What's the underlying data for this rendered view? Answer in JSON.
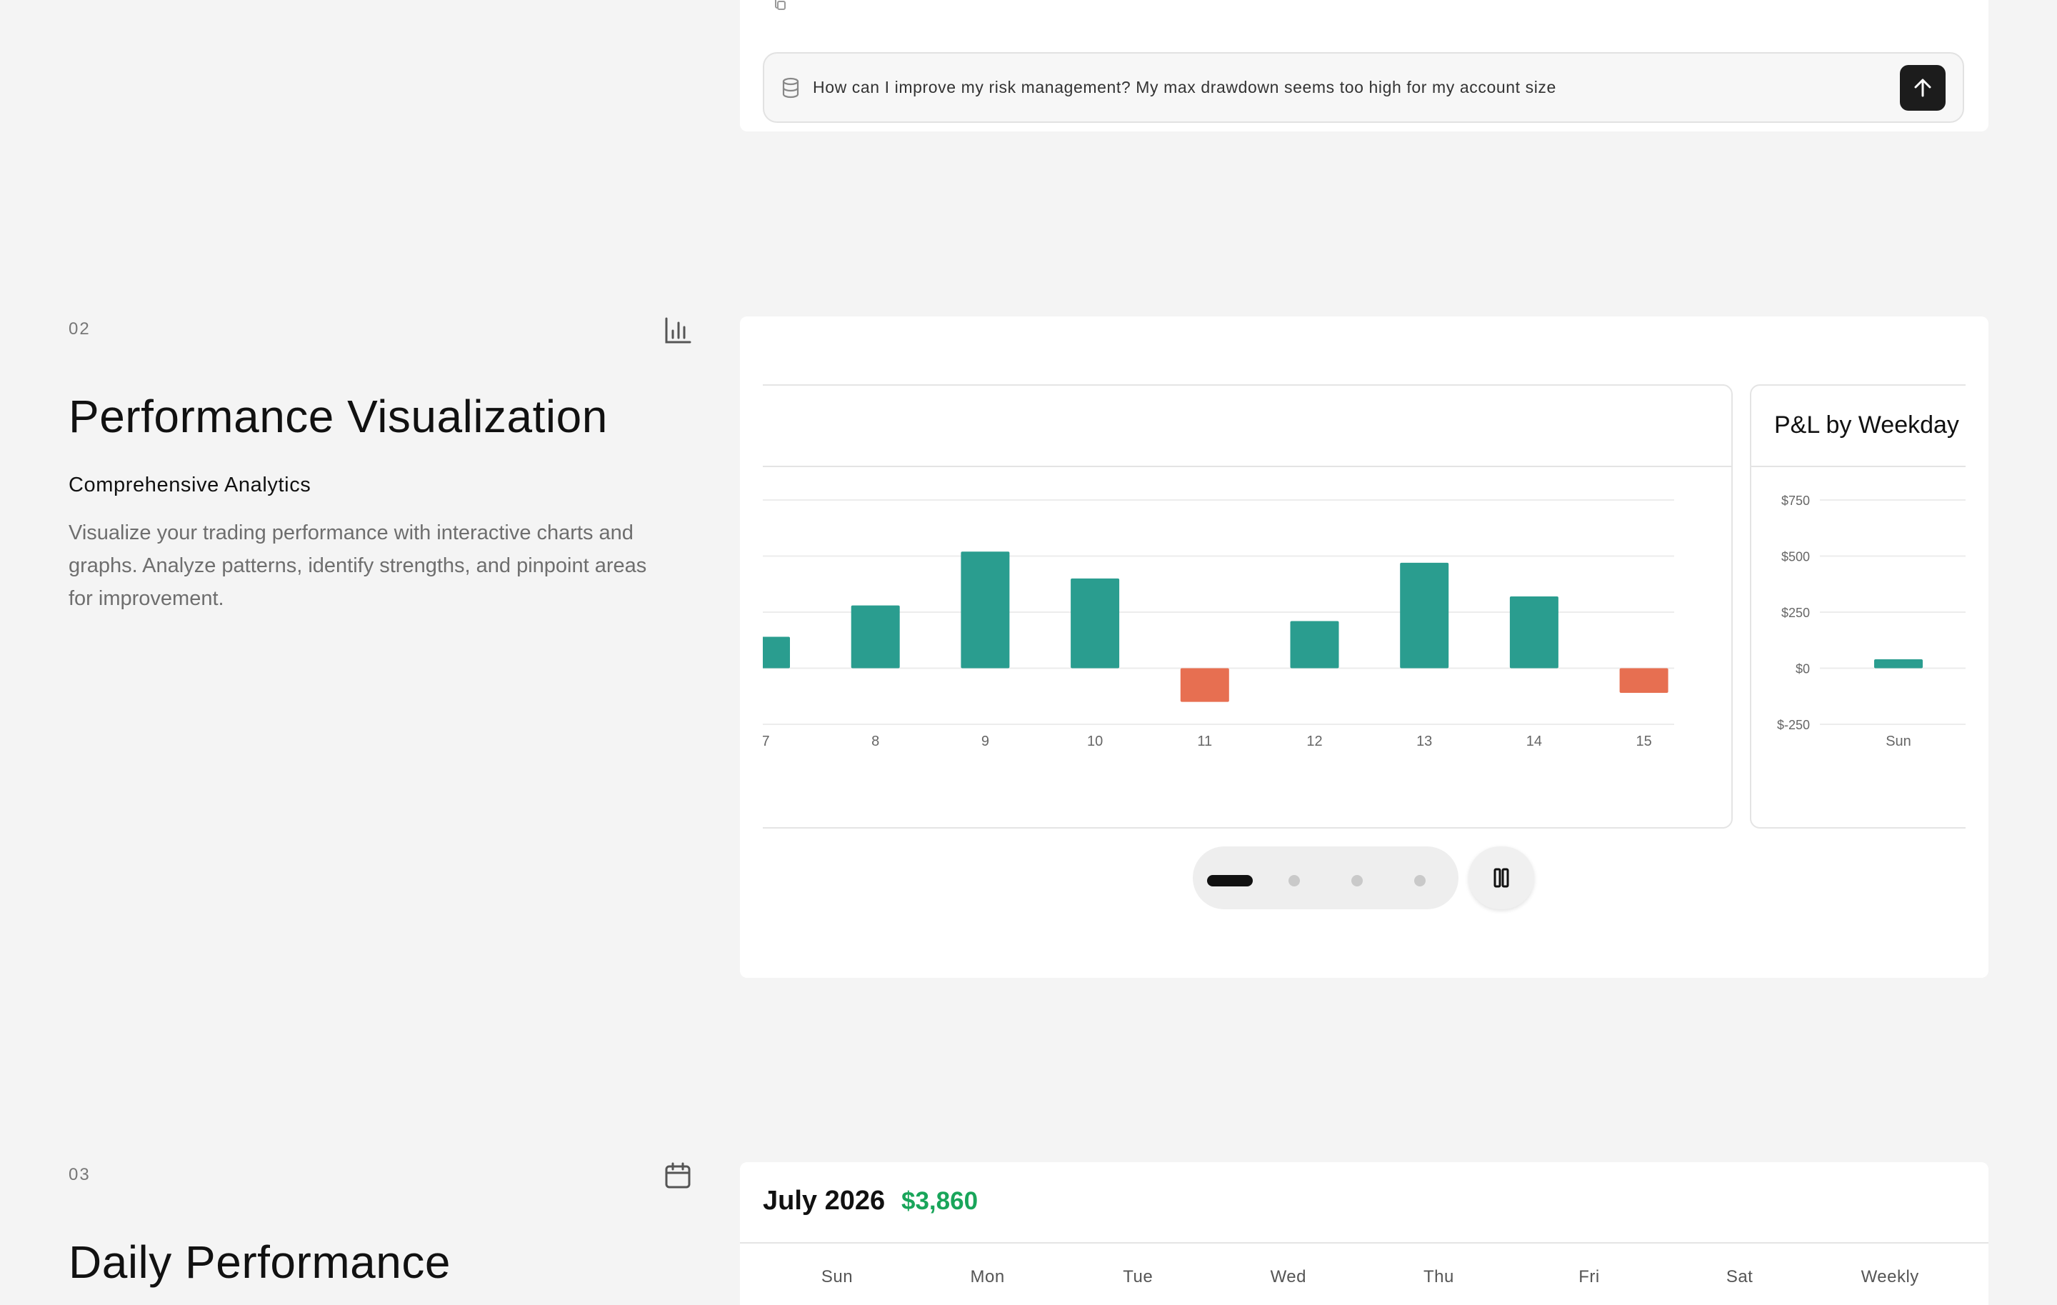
{
  "chat": {
    "input_value": "How can I improve my risk management? My max drawdown seems too high for my account size",
    "icons": {
      "attach": "database-icon",
      "send": "arrow-up-icon",
      "copy": "copy-icon"
    }
  },
  "section_02": {
    "number": "02",
    "icon": "bar-chart-icon",
    "title": "Performance Visualization",
    "subtitle": "Comprehensive Analytics",
    "description": "Visualize your trading performance with interactive charts and graphs. Analyze patterns, identify strengths, and pinpoint areas for improvement."
  },
  "carousel": {
    "slide_count": 4,
    "active_index": 0,
    "pause_icon": "pause-icon"
  },
  "chart_data": [
    {
      "type": "bar",
      "title": "",
      "title_fragment": ",",
      "categories": [
        "7",
        "8",
        "9",
        "10",
        "11",
        "12",
        "13",
        "14",
        "15"
      ],
      "values": [
        140,
        280,
        520,
        400,
        -150,
        210,
        470,
        320,
        -110
      ],
      "ylim": [
        -250,
        750
      ],
      "grid": true,
      "colors": {
        "positive": "#2a9d8f",
        "negative": "#e76f51"
      }
    },
    {
      "type": "bar",
      "title": "P&L by Weekday",
      "categories": [
        "Sun"
      ],
      "values": [
        40
      ],
      "yticks": [
        "$750",
        "$500",
        "$250",
        "$0",
        "$-250"
      ],
      "ylim": [
        -250,
        750
      ],
      "grid": true,
      "colors": {
        "positive": "#2a9d8f",
        "negative": "#e76f51"
      }
    }
  ],
  "section_03": {
    "number": "03",
    "icon": "calendar-icon",
    "title": "Daily Performance"
  },
  "calendar": {
    "month": "July 2026",
    "total": "$3,860",
    "days": [
      "Sun",
      "Mon",
      "Tue",
      "Wed",
      "Thu",
      "Fri",
      "Sat",
      "Weekly"
    ]
  }
}
